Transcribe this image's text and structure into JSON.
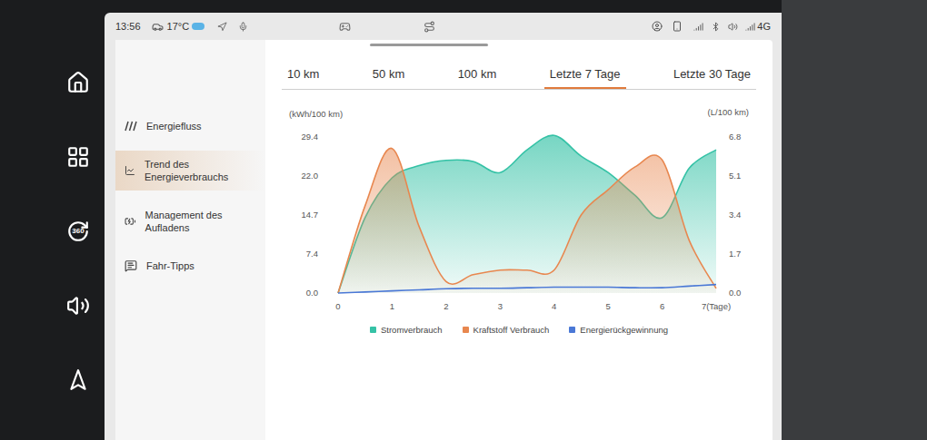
{
  "status_bar": {
    "time": "13:56",
    "temperature": "17°C",
    "network": "4G"
  },
  "dock": {
    "rotate_label": "360"
  },
  "sidebar": {
    "items": [
      {
        "label": "Energiefluss",
        "selected": false,
        "kind": "flow"
      },
      {
        "label": "Trend des Energieverbrauchs",
        "selected": true,
        "kind": "trend"
      },
      {
        "label": "Management des Aufladens",
        "selected": false,
        "kind": "charge"
      },
      {
        "label": "Fahr-Tipps",
        "selected": false,
        "kind": "tips"
      }
    ]
  },
  "tabs": [
    {
      "label": "10 km",
      "selected": false
    },
    {
      "label": "50 km",
      "selected": false
    },
    {
      "label": "100 km",
      "selected": false
    },
    {
      "label": "Letzte 7 Tage",
      "selected": true
    },
    {
      "label": "Letzte 30 Tage",
      "selected": false
    }
  ],
  "chart": {
    "left_unit": "(kWh/100 km)",
    "right_unit": "(L/100 km)",
    "left_ticks": [
      "29.4",
      "22.0",
      "14.7",
      "7.4",
      "0.0"
    ],
    "right_ticks": [
      "6.8",
      "5.1",
      "3.4",
      "1.7",
      "0.0"
    ],
    "x_ticks": [
      "0",
      "1",
      "2",
      "3",
      "4",
      "5",
      "6",
      "7(Tage)"
    ],
    "x": [
      0,
      0.5,
      1,
      1.5,
      2,
      2.5,
      3,
      3.5,
      4,
      4.5,
      5,
      5.5,
      6,
      6.5,
      7
    ],
    "series": [
      {
        "name": "Stromverbrauch",
        "axis": "left",
        "color": "#35c2a6",
        "values": [
          0,
          14.2,
          21.7,
          24,
          25,
          24.8,
          22.7,
          27,
          29.7,
          25.8,
          22.7,
          18.4,
          14.2,
          23.5,
          27
        ]
      },
      {
        "name": "Kraftstoff Verbrauch",
        "axis": "right",
        "color": "#e8874f",
        "values": [
          0,
          3.8,
          6.3,
          2.9,
          0.5,
          0.8,
          1.0,
          1.0,
          1.0,
          3.4,
          4.5,
          5.5,
          5.8,
          2.3,
          0.2
        ]
      },
      {
        "name": "Energierückgewinnung",
        "axis": "left",
        "color": "#4a78d6",
        "values": [
          0,
          0.2,
          0.4,
          0.6,
          0.8,
          0.9,
          0.9,
          1.0,
          1.1,
          1.1,
          1.1,
          1.0,
          1.0,
          1.3,
          1.6
        ]
      }
    ]
  }
}
